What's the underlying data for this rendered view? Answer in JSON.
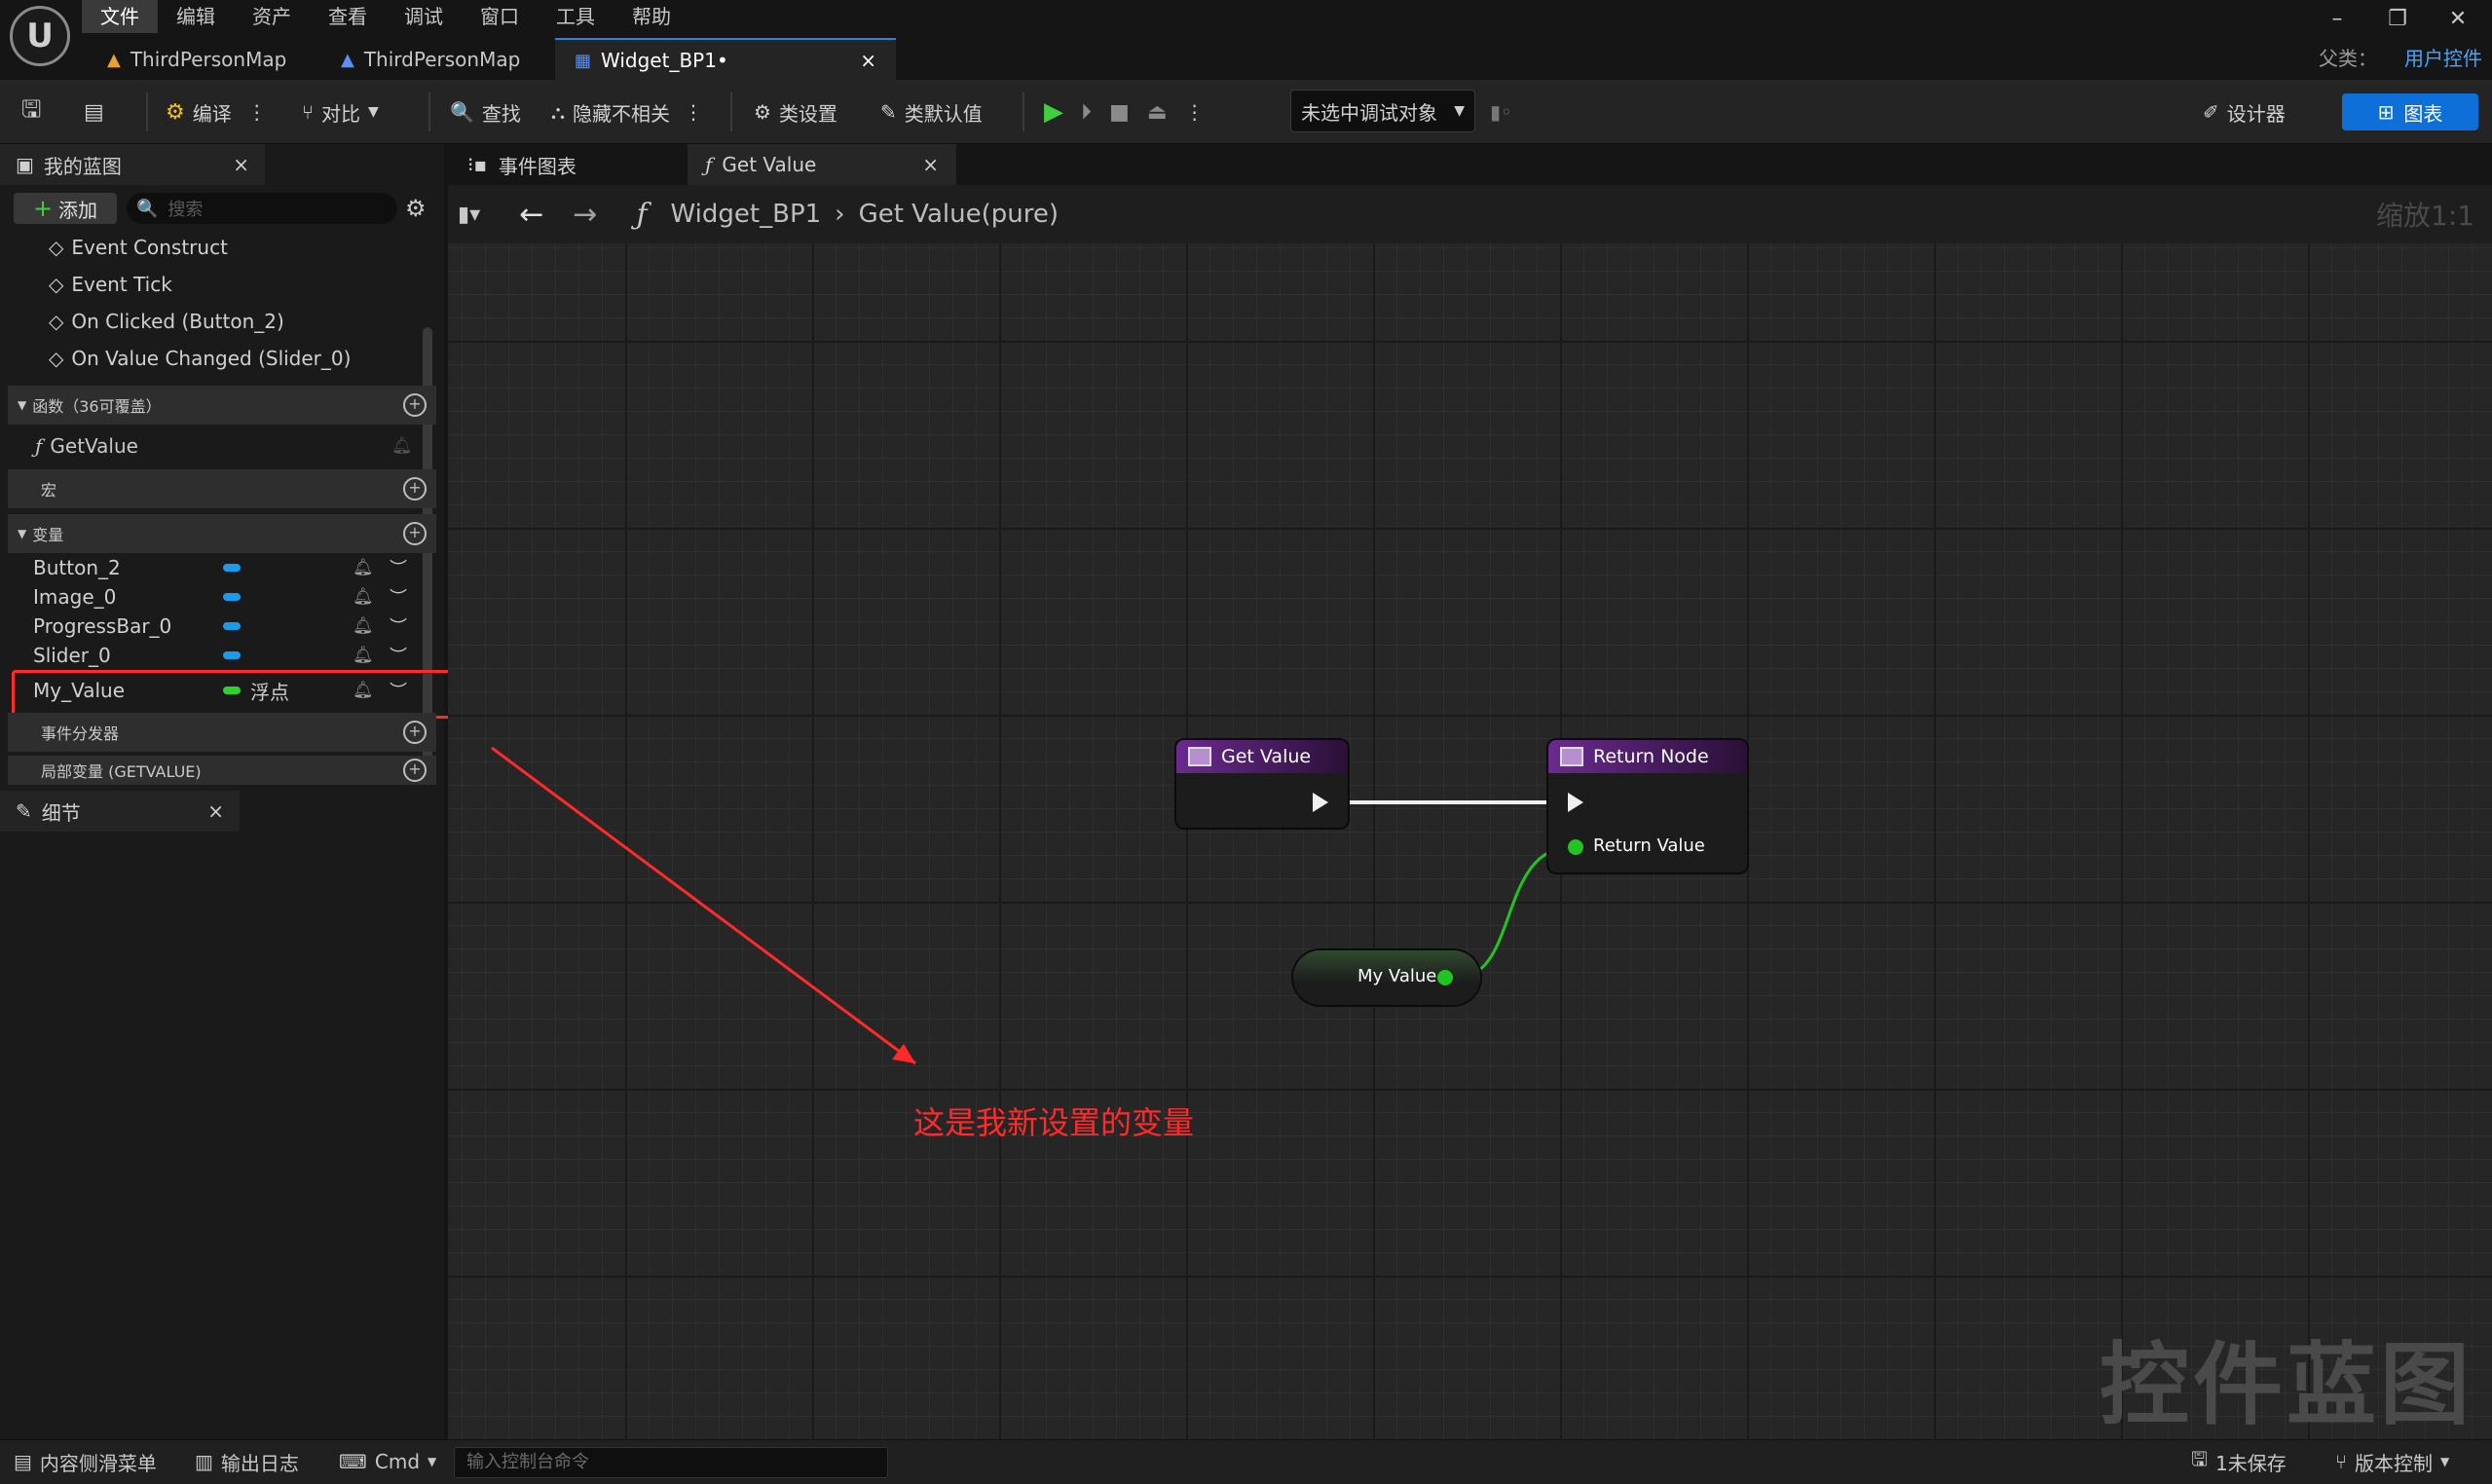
{
  "menu": [
    "文件",
    "编辑",
    "资产",
    "查看",
    "调试",
    "窗口",
    "工具",
    "帮助"
  ],
  "tabs": [
    {
      "label": "ThirdPersonMap"
    },
    {
      "label": "ThirdPersonMap"
    },
    {
      "label": "Widget_BP1•",
      "close": "×"
    }
  ],
  "parent": {
    "label": "父类：",
    "value": "用户控件"
  },
  "toolbar": {
    "compile": "编译",
    "diff": "对比",
    "find": "查找",
    "hide_unrelated": "隐藏不相关",
    "class_settings": "类设置",
    "class_defaults": "类默认值",
    "debug_select": "未选中调试对象",
    "designer": "设计器",
    "graph": "图表"
  },
  "my_blueprint": {
    "tab": "我的蓝图",
    "close": "×",
    "add": "添加",
    "search_placeholder": "搜索",
    "events": [
      "Event Construct",
      "Event Tick",
      "On Clicked (Button_2)",
      "On Value Changed (Slider_0)"
    ],
    "functions_header": "函数（36可覆盖）",
    "functions": [
      "GetValue"
    ],
    "macros_header": "宏",
    "variables_header": "变量",
    "variables": [
      {
        "name": "Button_2",
        "color": "#1a9ce8"
      },
      {
        "name": "Image_0",
        "color": "#1a9ce8"
      },
      {
        "name": "ProgressBar_0",
        "color": "#1a9ce8"
      },
      {
        "name": "Slider_0",
        "color": "#1a9ce8"
      },
      {
        "name": "My_Value",
        "type": "浮点",
        "color": "#2fd12f"
      }
    ],
    "dispatchers_header": "事件分发器",
    "locals_header": "局部变量 (GETVALUE)"
  },
  "details": {
    "tab": "细节",
    "close": "×"
  },
  "graph": {
    "tab_event_graph": "事件图表",
    "tab_function": "Get Value",
    "tab_function_close": "×",
    "breadcrumb_root": "Widget_BP1",
    "breadcrumb_leaf": "Get Value(pure)",
    "zoom": "缩放1:1",
    "watermark": "控件蓝图",
    "annotation": "这是我新设置的变量",
    "annotation_color": "#ff2a2a",
    "nodes": {
      "entry_title": "Get Value",
      "return_title": "Return Node",
      "return_pin": "Return Value",
      "getter_label": "My Value"
    }
  },
  "statusbar": {
    "content_drawer": "内容侧滑菜单",
    "output_log": "输出日志",
    "cmd": "Cmd",
    "console_placeholder": "输入控制台命令",
    "unsaved": "1未保存",
    "source_control": "版本控制"
  }
}
